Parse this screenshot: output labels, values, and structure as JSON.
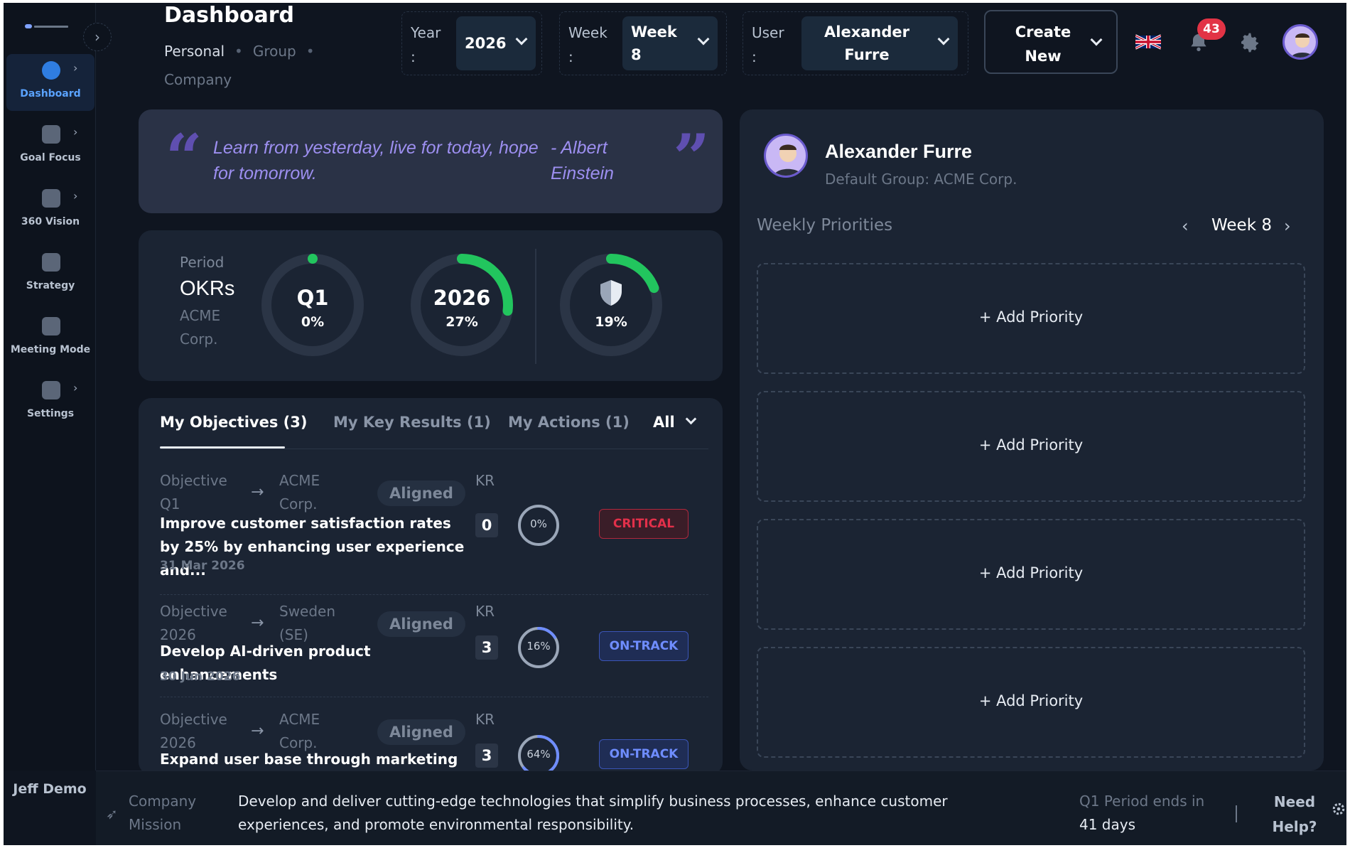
{
  "sidebar": {
    "items": [
      {
        "label": "Dashboard",
        "icon": "gauge-icon",
        "active": true,
        "has_chevron": true
      },
      {
        "label": "Goal Focus",
        "icon": "target-icon",
        "active": false,
        "has_chevron": true
      },
      {
        "label": "360 Vision",
        "icon": "layers-icon",
        "active": false,
        "has_chevron": true
      },
      {
        "label": "Strategy",
        "icon": "strategy-icon",
        "active": false,
        "has_chevron": false
      },
      {
        "label": "Meeting Mode",
        "icon": "calendar-icon",
        "active": false,
        "has_chevron": false
      },
      {
        "label": "Settings",
        "icon": "sliders-icon",
        "active": false,
        "has_chevron": true
      }
    ],
    "user_name": "Jeff Demo"
  },
  "header": {
    "title": "Dashboard",
    "scopes": [
      "Personal",
      "Group",
      "Company"
    ],
    "active_scope": "Personal",
    "year": {
      "label": "Year",
      "suffix": ":",
      "value": "2026"
    },
    "week": {
      "label": "Week",
      "suffix": ":",
      "value_line1": "Week",
      "value_line2": "8"
    },
    "user": {
      "label": "User",
      "suffix": ":",
      "value_line1": "Alexander",
      "value_line2": "Furre"
    },
    "create": {
      "line1": "Create",
      "line2": "New"
    },
    "notifications_count": "43",
    "flag": "uk-flag-icon"
  },
  "quote": {
    "text": "Learn from yesterday, live for today, hope for tomorrow.",
    "author": "- Albert Einstein"
  },
  "okr_summary": {
    "period_label": "Period",
    "title": "OKRs",
    "group": "ACME Corp.",
    "rings": [
      {
        "title": "Q1",
        "percent_text": "0%",
        "progress": 0.0,
        "color": "#22c55e"
      },
      {
        "title": "2026",
        "percent_text": "27%",
        "progress": 0.27,
        "color": "#22c55e"
      },
      {
        "title": "",
        "icon": "shield-icon",
        "percent_text": "19%",
        "progress": 0.19,
        "color": "#22c55e"
      }
    ]
  },
  "objectives": {
    "tabs": [
      {
        "label": "My Objectives (3)",
        "active": true
      },
      {
        "label": "My Key Results (1)",
        "active": false
      },
      {
        "label": "My Actions (1)",
        "active": false
      }
    ],
    "filter": "All",
    "rows": [
      {
        "meta_line1": "Objective",
        "meta_line2": "Q1",
        "group_line1": "ACME",
        "group_line2": "Corp.",
        "aligned": "Aligned",
        "kr_label": "KR",
        "kr_count": "0",
        "progress_text": "0%",
        "progress": 0.0,
        "status": "CRITICAL",
        "status_type": "critical",
        "title": "Improve customer satisfaction rates by 25% by enhancing user experience and...",
        "date": "31 Mar 2026"
      },
      {
        "meta_line1": "Objective",
        "meta_line2": "2026",
        "group_line1": "Sweden",
        "group_line2": "(SE)",
        "aligned": "Aligned",
        "kr_label": "KR",
        "kr_count": "3",
        "progress_text": "16%",
        "progress": 0.16,
        "status": "ON-TRACK",
        "status_type": "ontrack",
        "title": "Develop AI-driven product enhancements",
        "date": "30 Jun 2026"
      },
      {
        "meta_line1": "Objective",
        "meta_line2": "2026",
        "group_line1": "ACME",
        "group_line2": "Corp.",
        "aligned": "Aligned",
        "kr_label": "KR",
        "kr_count": "3",
        "progress_text": "64%",
        "progress": 0.64,
        "status": "ON-TRACK",
        "status_type": "ontrack",
        "title": "Expand user base through marketing and...",
        "date": ""
      }
    ]
  },
  "profile": {
    "name": "Alexander Furre",
    "default_group": "Default Group: ACME Corp.",
    "weekly_priorities_label": "Weekly Priorities",
    "week_label": "Week 8",
    "priorities": [
      "+ Add Priority",
      "+ Add Priority",
      "+ Add Priority",
      "+ Add Priority"
    ]
  },
  "footer": {
    "mission_label": "Company Mission",
    "mission_text": "Develop and deliver cutting-edge technologies that simplify business processes, enhance customer experiences, and promote environmental responsibility.",
    "period_line1": "Q1 Period ends in",
    "period_line2": "41 days",
    "help_line1": "Need",
    "help_line2": "Help?"
  },
  "colors": {
    "background": "#0f1520",
    "card": "#1b2433",
    "accent_blue": "#2f7de1",
    "ring_green": "#22c55e",
    "critical_red": "#e2304a",
    "ontrack_blue": "#6f8dff",
    "quote_purple": "#9d8ff0"
  }
}
